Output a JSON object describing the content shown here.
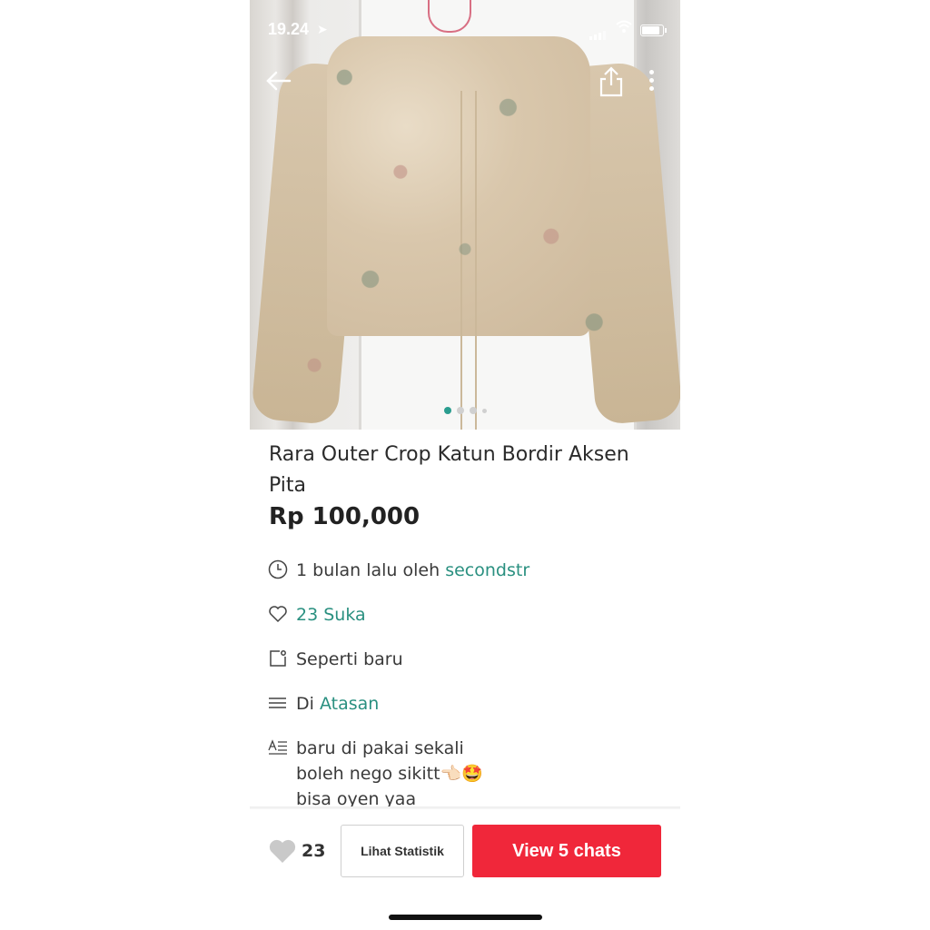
{
  "status_bar": {
    "time": "19.24"
  },
  "product": {
    "title": "Rara Outer Crop Katun Bordir Aksen Pita",
    "price": "Rp 100,000"
  },
  "info": {
    "posted_text": "1 bulan lalu oleh ",
    "seller": "secondstr",
    "likes_label": "23 Suka",
    "condition": "Seperti baru",
    "category_prefix": "Di ",
    "category": "Atasan",
    "description_lines": [
      "baru di pakai sekali",
      "boleh nego sikitt👈🏻🤩",
      "bisa oyen yaa"
    ]
  },
  "bottom_bar": {
    "like_count": "23",
    "stats_label": "Lihat Statistik",
    "chats_label": "View 5 chats"
  },
  "carousel": {
    "count": 4,
    "active": 0
  },
  "colors": {
    "accent": "#2a9080",
    "cta": "#f0273a"
  }
}
